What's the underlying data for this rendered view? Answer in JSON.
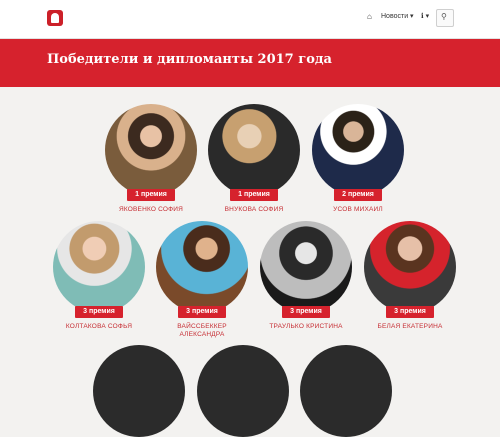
{
  "nav": {
    "home_icon": "⌂",
    "news": "Новости ▾",
    "info": "ℹ ▾",
    "search_icon": "⚲"
  },
  "banner": {
    "title": "Победители и дипломанты 2017 года"
  },
  "winners": [
    {
      "prize": "1 премия",
      "name": "ЯКОВЕНКО СОФИЯ"
    },
    {
      "prize": "1 премия",
      "name": "ВНУКОВА СОФИЯ"
    },
    {
      "prize": "2 премия",
      "name": "УСОВ МИХАИЛ"
    },
    {
      "prize": "3 премия",
      "name": "КОЛТАКОВА СОФЬЯ"
    },
    {
      "prize": "3 премия",
      "name": "ВАЙССБЕККЕР АЛЕКСАНДРА"
    },
    {
      "prize": "3 премия",
      "name": "ТРАУЛЬКО КРИСТИНА"
    },
    {
      "prize": "3 премия",
      "name": "БЕЛАЯ ЕКАТЕРИНА"
    }
  ],
  "colors": {
    "accent": "#d6222d",
    "name_text": "#c62d33"
  }
}
